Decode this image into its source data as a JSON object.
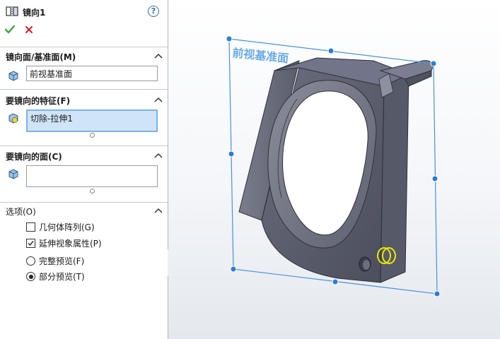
{
  "window": {
    "title": "镜向1",
    "help_label": "?"
  },
  "sections": {
    "mirror_plane": {
      "header": "镜向面/基准面(M)",
      "value": "前视基准面"
    },
    "features": {
      "header": "要镜向的特征(F)",
      "value": "切除-拉伸1"
    },
    "faces": {
      "header": "要镜向的面(C)",
      "value": ""
    },
    "options": {
      "header": "选项(O)",
      "geometry_pattern": {
        "label": "几何体阵列(G)",
        "checked": false
      },
      "propagate_visual": {
        "label": "延伸视象属性(P)",
        "checked": true
      },
      "full_preview": {
        "label": "完整预览(F)",
        "selected": false
      },
      "partial_preview": {
        "label": "部分预览(T)",
        "selected": true
      }
    }
  },
  "viewport": {
    "plane_label": "前视基准面",
    "plane_color": "#4a90d9",
    "part_color": "#5c5f6e"
  },
  "colors": {
    "ok": "#3aa23a",
    "cancel": "#d02020",
    "accent": "#3a6ea5"
  }
}
